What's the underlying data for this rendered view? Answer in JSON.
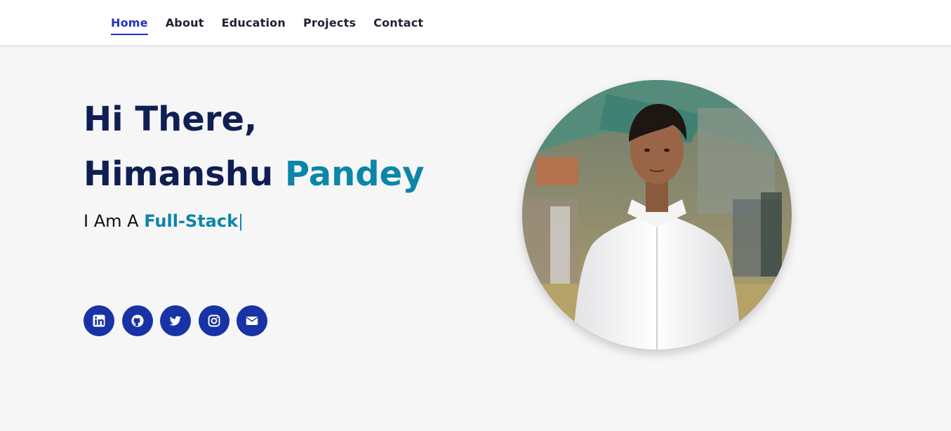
{
  "nav": {
    "items": [
      {
        "label": "Home",
        "active": true
      },
      {
        "label": "About",
        "active": false
      },
      {
        "label": "Education",
        "active": false
      },
      {
        "label": "Projects",
        "active": false
      },
      {
        "label": "Contact",
        "active": false
      }
    ]
  },
  "hero": {
    "greeting": "Hi There,",
    "first_name": "Himanshu",
    "last_name": "Pandey",
    "typed_prefix": "I Am A",
    "typed_role": "Full-Stack",
    "typed_cursor": "|"
  },
  "socials": [
    {
      "name": "linkedin-icon"
    },
    {
      "name": "github-icon"
    },
    {
      "name": "twitter-icon"
    },
    {
      "name": "instagram-icon"
    },
    {
      "name": "email-icon"
    }
  ],
  "colors": {
    "nav_active": "#2230c6",
    "heading": "#0f1f54",
    "accent": "#0a86a8",
    "social_bg": "#1733a6",
    "page_bg": "#f6f6f7"
  }
}
